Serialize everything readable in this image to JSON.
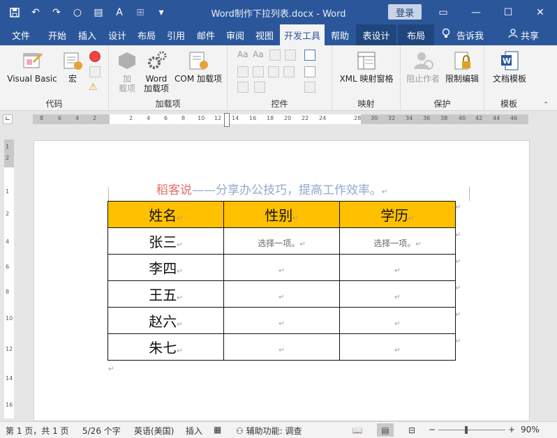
{
  "window": {
    "title": "Word制作下拉列表.docx  -  Word",
    "login_label": "登录",
    "qat_icons": [
      "save-icon",
      "undo-icon",
      "redo-icon",
      "circle-icon",
      "form-icon",
      "font-icon",
      "format-icon",
      "more-icon"
    ]
  },
  "tabs": [
    {
      "label": "文件"
    },
    {
      "label": "开始"
    },
    {
      "label": "插入"
    },
    {
      "label": "设计"
    },
    {
      "label": "布局"
    },
    {
      "label": "引用"
    },
    {
      "label": "邮件"
    },
    {
      "label": "审阅"
    },
    {
      "label": "视图"
    },
    {
      "label": "开发工具"
    },
    {
      "label": "帮助"
    },
    {
      "label": "表设计"
    },
    {
      "label": "布局"
    }
  ],
  "tell_me": "告诉我",
  "share": "共享",
  "ribbon": {
    "groups": [
      {
        "label": "代码",
        "buttons": [
          "Visual Basic",
          "宏"
        ]
      },
      {
        "label": "加载项",
        "buttons": [
          "加\n载项",
          "Word\n加载项",
          "COM 加载项"
        ]
      },
      {
        "label": "控件",
        "buttons": []
      },
      {
        "label": "映射",
        "buttons": [
          "XML 映射窗格"
        ]
      },
      {
        "label": "保护",
        "buttons": [
          "阻止作者",
          "限制编辑"
        ]
      },
      {
        "label": "模板",
        "buttons": [
          "文档模板"
        ]
      }
    ]
  },
  "ruler": {
    "left_ticks": [
      "8",
      "6",
      "4",
      "2"
    ],
    "right_ticks": [
      "2",
      "4",
      "6",
      "8",
      "10",
      "12",
      "14",
      "16",
      "18",
      "20",
      "22",
      "24",
      "28",
      "30",
      "32",
      "34",
      "36",
      "38",
      "40",
      "42",
      "44",
      "46"
    ]
  },
  "vruler_ticks": [
    "1",
    "2",
    "1",
    "2",
    "4",
    "6",
    "8",
    "10",
    "12",
    "14",
    "16"
  ],
  "document": {
    "header_red": "稻客说",
    "header_blue": "——分享办公技巧，提高工作效率。",
    "table_headers": [
      "姓名",
      "性别",
      "学历"
    ],
    "rows": [
      {
        "name": "张三",
        "gender": "选择一项。",
        "edu": "选择一项。"
      },
      {
        "name": "李四",
        "gender": "",
        "edu": ""
      },
      {
        "name": "王五",
        "gender": "",
        "edu": ""
      },
      {
        "name": "赵六",
        "gender": "",
        "edu": ""
      },
      {
        "name": "朱七",
        "gender": "",
        "edu": ""
      }
    ]
  },
  "status": {
    "page": "第 1 页，共 1 页",
    "words": "5/26 个字",
    "language": "英语(美国)",
    "mode": "插入",
    "accessibility": "辅助功能: 调查",
    "zoom": "90%"
  }
}
